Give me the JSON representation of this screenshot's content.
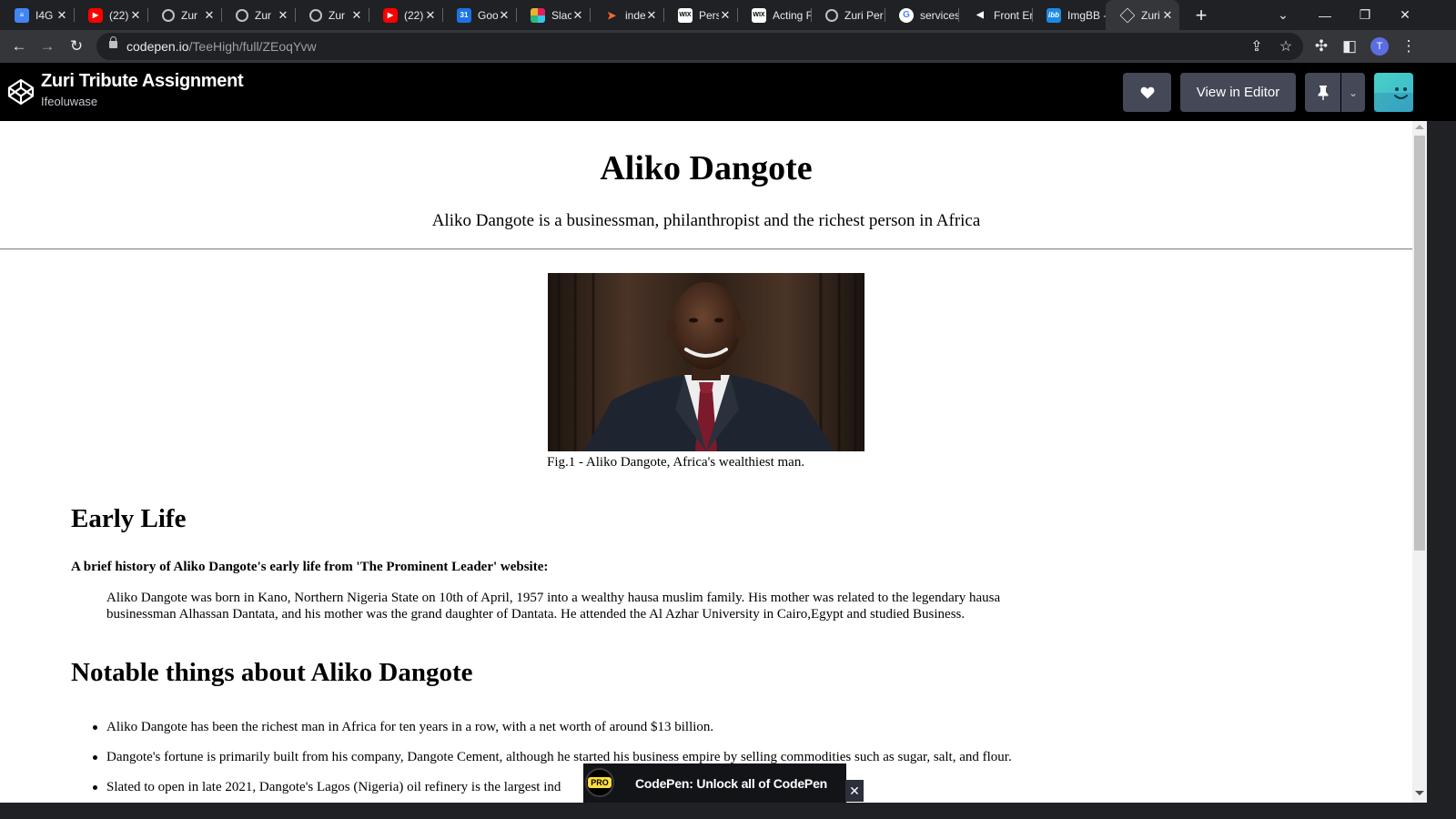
{
  "browser": {
    "tabs": [
      {
        "icon": "docs-icon",
        "title": "I4G",
        "active": false
      },
      {
        "icon": "youtube-icon",
        "title": "(22)",
        "active": false
      },
      {
        "icon": "globe-icon",
        "title": "Zur",
        "active": false
      },
      {
        "icon": "globe-icon",
        "title": "Zur",
        "active": false
      },
      {
        "icon": "globe-icon",
        "title": "Zur",
        "active": false
      },
      {
        "icon": "youtube-icon",
        "title": "(22)",
        "active": false
      },
      {
        "icon": "calendar-icon",
        "title": "Goo",
        "active": false
      },
      {
        "icon": "slack-icon",
        "title": "Slac",
        "active": false
      },
      {
        "icon": "indeed-icon",
        "title": "inde",
        "active": false
      },
      {
        "icon": "wix-icon",
        "title": "Pers",
        "active": false
      },
      {
        "icon": "wix-icon",
        "title": "Acting F",
        "active": false
      },
      {
        "icon": "globe-icon",
        "title": "Zuri Per",
        "active": false
      },
      {
        "icon": "google-icon",
        "title": "services",
        "active": false
      },
      {
        "icon": "frontend-icon",
        "title": "Front Er",
        "active": false
      },
      {
        "icon": "imgbb-icon",
        "title": "ImgBB -",
        "active": false
      },
      {
        "icon": "codepen-icon",
        "title": "Zuri",
        "active": true
      }
    ],
    "url_host": "codepen.io",
    "url_path": "/TeeHigh/full/ZEoqYvw",
    "profile_initial": "T"
  },
  "codepen": {
    "title": "Zuri Tribute Assignment",
    "author": "Ifeoluwase",
    "view_in_editor": "View in Editor",
    "promo_text": "CodePen: Unlock all of CodePen",
    "pro_badge": "PRO",
    "colors": {
      "header_bg": "#000000",
      "button_bg": "#444857",
      "pro_yellow": "#ffdd40"
    }
  },
  "page": {
    "title": "Aliko Dangote",
    "subtitle": "Aliko Dangote is a businessman, philanthropist and the richest person in Africa",
    "caption": "Fig.1 - Aliko Dangote, Africa's wealthiest man.",
    "early_life": {
      "heading": "Early Life",
      "intro": "A brief history of Aliko Dangote's early life from 'The Prominent Leader' website:",
      "quote": "Aliko Dangote was born in Kano, Northern Nigeria State on 10th of April, 1957 into a wealthy hausa muslim family. His mother was related to the legendary hausa businessman Alhassan Dantata, and his mother was the grand daughter of Dantata. He attended the Al Azhar University in Cairo,Egypt and studied Business."
    },
    "notable": {
      "heading": "Notable things about Aliko Dangote",
      "items": [
        "Aliko Dangote has been the richest man in Africa for ten years in a row, with a net worth of around $13 billion.",
        "Dangote's fortune is primarily built from his company, Dangote Cement, although he started his business empire by selling commodities such as sugar, salt, and flour.",
        "Slated to open in late 2021, Dangote's Lagos (Nigeria) oil refinery is the largest ind"
      ]
    }
  }
}
